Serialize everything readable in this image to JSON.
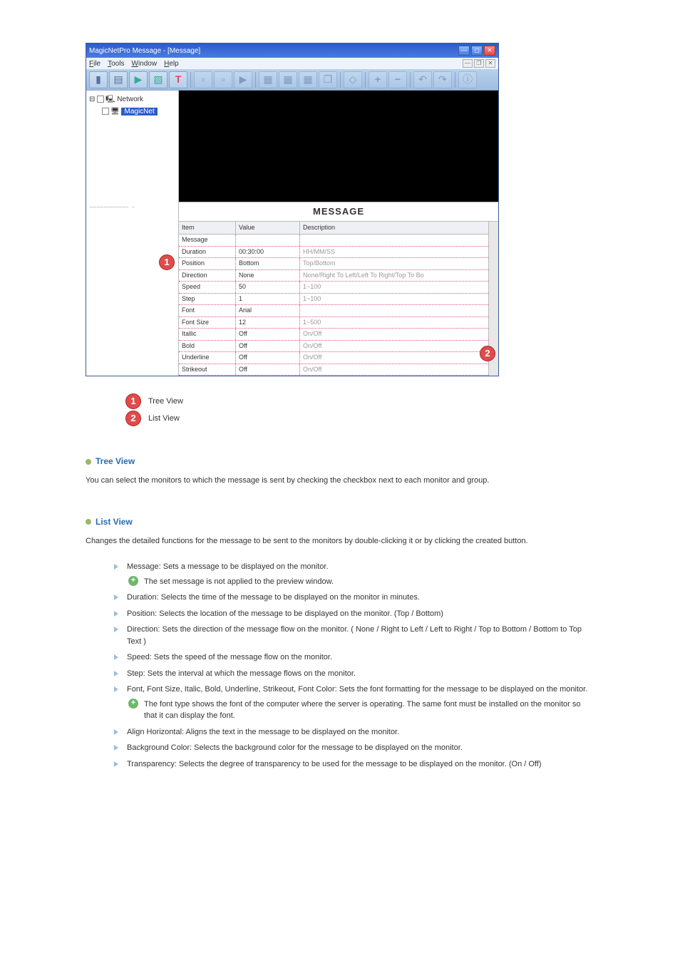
{
  "app": {
    "title": "MagicNetPro Message - [Message]",
    "menus": [
      "File",
      "Tools",
      "Window",
      "Help"
    ]
  },
  "tree": {
    "root": "Network",
    "child": "MagicNet"
  },
  "grid": {
    "title": "MESSAGE",
    "headers": [
      "Item",
      "Value",
      "Description"
    ],
    "rows": [
      {
        "item": "Message",
        "value": "",
        "desc": ""
      },
      {
        "item": "Duration",
        "value": "00:30:00",
        "desc": "HH/MM/SS"
      },
      {
        "item": "Position",
        "value": "Bottom",
        "desc": "Top/Bottom"
      },
      {
        "item": "Direction",
        "value": "None",
        "desc": "None/Right To Left/Left To Right/Top To Bo"
      },
      {
        "item": "Speed",
        "value": "50",
        "desc": "1~100"
      },
      {
        "item": "Step",
        "value": "1",
        "desc": "1~100"
      },
      {
        "item": "Font",
        "value": "Arial",
        "desc": ""
      },
      {
        "item": "Font Size",
        "value": "12",
        "desc": "1~500"
      },
      {
        "item": "Itallic",
        "value": "Off",
        "desc": "On/Off"
      },
      {
        "item": "Bold",
        "value": "Off",
        "desc": "On/Off"
      },
      {
        "item": "Underline",
        "value": "Off",
        "desc": "On/Off"
      },
      {
        "item": "Strikeout",
        "value": "Off",
        "desc": "On/Off"
      }
    ]
  },
  "callouts": {
    "c1": "1",
    "c2": "2"
  },
  "legend": [
    {
      "num": "1",
      "label": "Tree View"
    },
    {
      "num": "2",
      "label": "List View"
    }
  ],
  "sections": {
    "tree": {
      "title": "Tree View",
      "body": "You can select the monitors to which the message is sent by checking the checkbox next to each monitor and group."
    },
    "list": {
      "title": "List View",
      "body": "Changes the detailed functions for the message to be sent to the monitors by double-clicking it or by clicking the created button.",
      "items": [
        {
          "text": "Message: Sets a message to be displayed on the monitor.",
          "sub": [
            "The set message is not applied to the preview window."
          ]
        },
        {
          "text": "Duration: Selects the time of the message to be displayed on the monitor in minutes."
        },
        {
          "text": "Position: Selects the location of the message to be displayed on the monitor. (Top / Bottom)"
        },
        {
          "text": "Direction: Sets the direction of the message flow on the monitor. ( None / Right to Left / Left to Right / Top to Bottom / Bottom to Top Text )"
        },
        {
          "text": "Speed: Sets the speed of the message flow on the monitor."
        },
        {
          "text": "Step: Sets the interval at which the message flows on the monitor."
        },
        {
          "text": "Font, Font Size, Italic, Bold, Underline, Strikeout, Font Color: Sets the font formatting for the message to be displayed on the monitor.",
          "sub": [
            "The font type shows the font of the computer where the server is operating. The same font must be installed on the monitor so that it can display the font."
          ]
        },
        {
          "text": "Align Horizontal: Aligns the text in the message to be displayed on the monitor."
        },
        {
          "text": "Background Color: Selects the background color for the message to be displayed on the monitor."
        },
        {
          "text": "Transparency: Selects the degree of transparency to be used for the message to be displayed on the monitor. (On / Off)"
        }
      ]
    }
  }
}
